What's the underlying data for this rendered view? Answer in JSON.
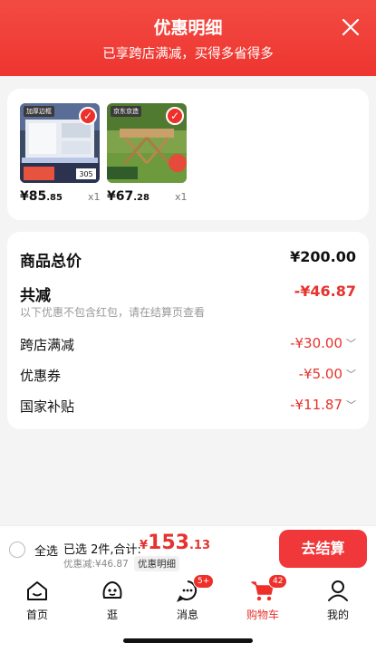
{
  "header": {
    "title": "优惠明细",
    "subtitle": "已享跨店满减，买得多省得多"
  },
  "products": [
    {
      "tag": "加厚边框",
      "price_int": "¥85",
      "price_dec": ".85",
      "qty": "x1"
    },
    {
      "tag": "京东京造",
      "price_int": "¥67",
      "price_dec": ".28",
      "qty": "x1"
    }
  ],
  "summary": {
    "goods_total_label": "商品总价",
    "goods_total_value": "¥200.00",
    "reduce_label": "共减",
    "reduce_value": "-¥46.87",
    "note": "以下优惠不包含红包，请在结算页查看",
    "items": [
      {
        "label": "跨店满减",
        "value": "-¥30.00"
      },
      {
        "label": "优惠券",
        "value": "-¥5.00"
      },
      {
        "label": "国家补贴",
        "value": "-¥11.87"
      }
    ]
  },
  "footer": {
    "select_all": "全选",
    "selected_text": "已选 2件,合计:",
    "total_currency": "¥",
    "total_int": "153",
    "total_dec": ".13",
    "discount_text": "优惠减:¥46.87",
    "detail_button": "优惠明细",
    "checkout_button": "去结算"
  },
  "tabs": [
    {
      "label": "首页",
      "icon": "home-icon",
      "badge": ""
    },
    {
      "label": "逛",
      "icon": "face-icon",
      "badge": ""
    },
    {
      "label": "消息",
      "icon": "message-icon",
      "badge": "5+"
    },
    {
      "label": "购物车",
      "icon": "cart-icon",
      "badge": "42"
    },
    {
      "label": "我的",
      "icon": "user-icon",
      "badge": ""
    }
  ],
  "colors": {
    "accent": "#ee2f2a",
    "price_red": "#e5332e"
  }
}
